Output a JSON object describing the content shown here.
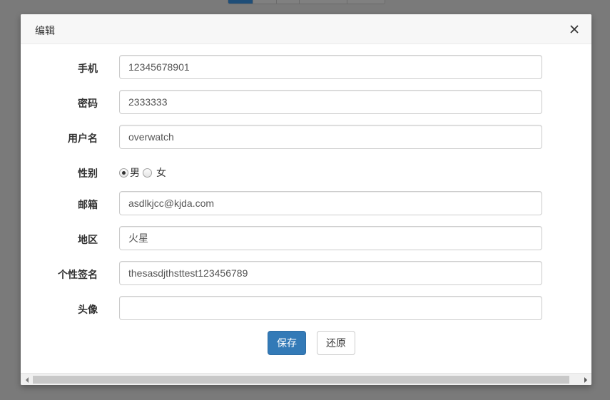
{
  "modal": {
    "title": "编辑"
  },
  "form": {
    "phone": {
      "label": "手机",
      "value": "12345678901"
    },
    "password": {
      "label": "密码",
      "value": "2333333"
    },
    "username": {
      "label": "用户名",
      "value": "overwatch"
    },
    "gender": {
      "label": "性别",
      "options": [
        "男",
        "女"
      ],
      "selected": "男"
    },
    "email": {
      "label": "邮箱",
      "value": "asdlkjcc@kjda.com"
    },
    "region": {
      "label": "地区",
      "value": "火星"
    },
    "signature": {
      "label": "个性签名",
      "value": "thesasdjthsttest123456789"
    },
    "avatar": {
      "label": "头像",
      "value": ""
    }
  },
  "actions": {
    "save_label": "保存",
    "reset_label": "还原"
  },
  "colors": {
    "primary": "#337ab7",
    "overlay": "#7a7a7a"
  }
}
